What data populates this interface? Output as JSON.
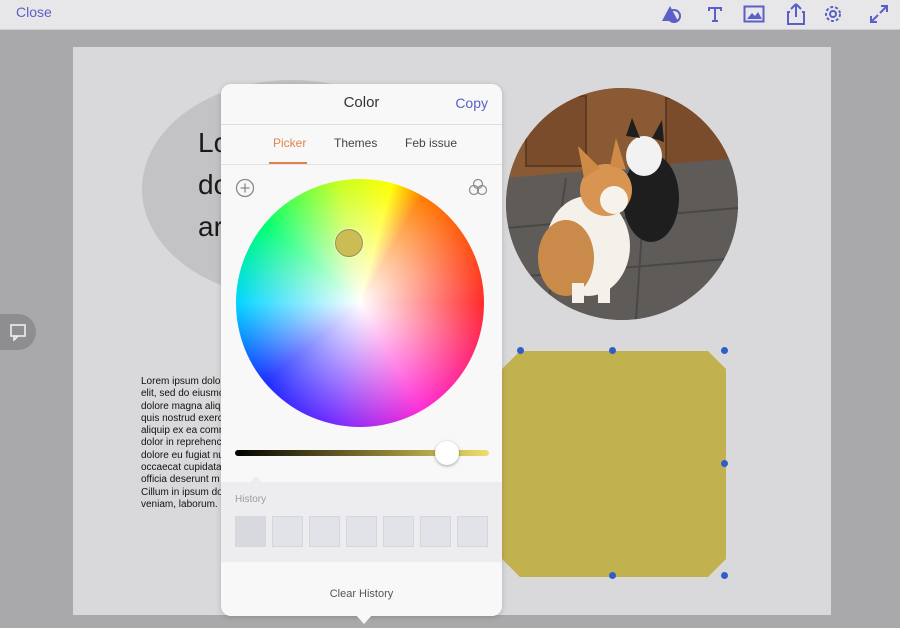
{
  "toolbar": {
    "close_label": "Close",
    "icons": [
      "shape-icon",
      "text-icon",
      "image-icon",
      "share-icon",
      "settings-icon",
      "fullscreen-icon"
    ]
  },
  "canvas": {
    "headline_lines": "Lo\ndo\nar",
    "body_text_lines": [
      "Lorem ipsum dolo",
      "elit, sed do eiusmo",
      "dolore magna aliq",
      "quis nostrud exerc",
      "aliquip ex ea comm",
      "dolor in reprehenc",
      "dolore eu fugiat nu",
      "occaecat cupidata",
      "officia deserunt m",
      "Cillum in ipsum do",
      "veniam, laborum."
    ],
    "shape_color": "#c2b14f"
  },
  "color_popover": {
    "title": "Color",
    "copy_label": "Copy",
    "tabs": [
      {
        "label": "Picker",
        "active": true
      },
      {
        "label": "Themes",
        "active": false
      },
      {
        "label": "Feb issue",
        "active": false
      }
    ],
    "selected_color": "#cbbd54",
    "brightness_slider_value": 0.84,
    "history_label": "History",
    "history_swatch_count": 7,
    "clear_history_label": "Clear History"
  },
  "colors": {
    "accent": "#5b5fc7",
    "active_tab": "#e0854a",
    "selection_handle": "#2f5ec6"
  }
}
